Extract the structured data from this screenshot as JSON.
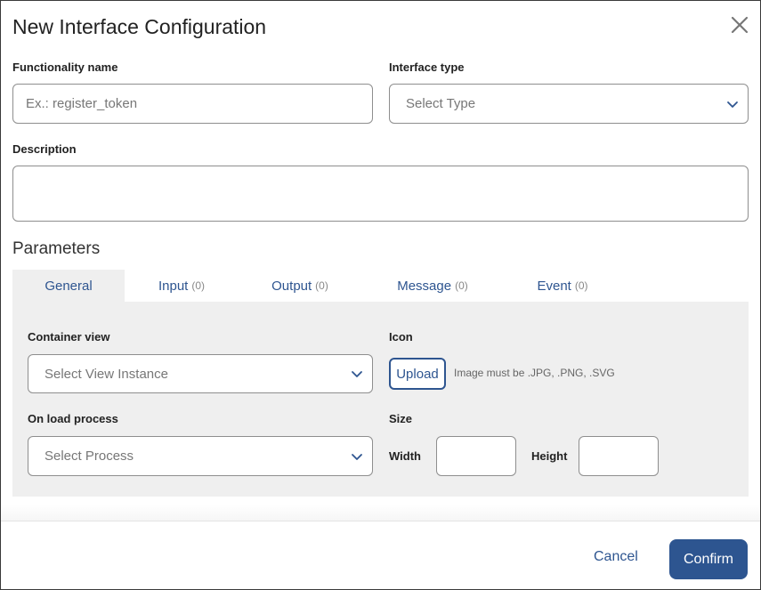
{
  "dialog": {
    "title": "New Interface Configuration",
    "close_icon": "close-icon"
  },
  "form": {
    "functionality_name": {
      "label": "Functionality name",
      "value": "",
      "placeholder": "Ex.: register_token"
    },
    "interface_type": {
      "label": "Interface type",
      "placeholder": "Select Type"
    },
    "description": {
      "label": "Description",
      "value": ""
    }
  },
  "parameters": {
    "title": "Parameters",
    "tabs": [
      {
        "label": "General",
        "count": ""
      },
      {
        "label": "Input",
        "count": "(0)"
      },
      {
        "label": "Output",
        "count": "(0)"
      },
      {
        "label": "Message",
        "count": "(0)"
      },
      {
        "label": "Event",
        "count": "(0)"
      }
    ],
    "active_tab": "General",
    "general": {
      "container_view": {
        "label": "Container view",
        "placeholder": "Select View Instance"
      },
      "on_load_process": {
        "label": "On load process",
        "placeholder": "Select Process"
      },
      "icon": {
        "label": "Icon",
        "upload_label": "Upload",
        "hint": "Image must be .JPG, .PNG, .SVG"
      },
      "size": {
        "label": "Size",
        "width_label": "Width",
        "height_label": "Height",
        "width_value": "",
        "height_value": ""
      }
    }
  },
  "footer": {
    "cancel_label": "Cancel",
    "confirm_label": "Confirm"
  },
  "colors": {
    "accent": "#2d5590",
    "panel_bg": "#efefef",
    "border": "#8e8e8e"
  }
}
